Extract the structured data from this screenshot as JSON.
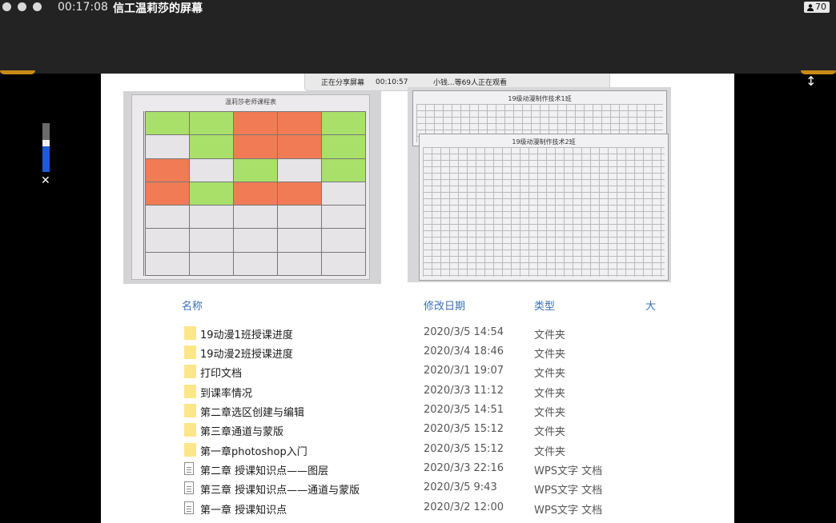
{
  "titlebar": {
    "timer": "00:17:08",
    "share_title": "信工温莉莎的屏幕",
    "viewer_count": "70",
    "viewer_icon": "person-icon"
  },
  "share_banner": {
    "sharing_label": "正在分享屏幕",
    "elapsed": "00:10:57",
    "watchers": "小钱...等69人正在观看"
  },
  "photos": {
    "schedule_title": "温莉莎老师课程表",
    "sheet1_title": "19级动漫制作技术1班",
    "sheet2_title": "19级动漫制作技术2班"
  },
  "file_list": {
    "columns": [
      "名称",
      "修改日期",
      "类型",
      "大"
    ],
    "rows": [
      {
        "name": "19动漫1班授课进度",
        "date": "2020/3/5 14:54",
        "type": "文件夹",
        "icon": "folder-icon"
      },
      {
        "name": "19动漫2班授课进度",
        "date": "2020/3/4 18:46",
        "type": "文件夹",
        "icon": "folder-icon"
      },
      {
        "name": "打印文档",
        "date": "2020/3/1 19:07",
        "type": "文件夹",
        "icon": "folder-icon"
      },
      {
        "name": "到课率情况",
        "date": "2020/3/3 11:12",
        "type": "文件夹",
        "icon": "folder-icon"
      },
      {
        "name": "第二章选区创建与编辑",
        "date": "2020/3/5 14:51",
        "type": "文件夹",
        "icon": "folder-icon"
      },
      {
        "name": "第三章通道与蒙版",
        "date": "2020/3/5 15:12",
        "type": "文件夹",
        "icon": "folder-icon"
      },
      {
        "name": "第一章photoshop入门",
        "date": "2020/3/5 15:12",
        "type": "文件夹",
        "icon": "folder-icon"
      },
      {
        "name": "第二章  授课知识点——图层",
        "date": "2020/3/3 22:16",
        "type": "WPS文字 文档",
        "icon": "document-icon"
      },
      {
        "name": "第三章  授课知识点——通道与蒙版",
        "date": "2020/3/5 9:43",
        "type": "WPS文字 文档",
        "icon": "document-icon"
      },
      {
        "name": "第一章  授课知识点",
        "date": "2020/3/2 12:00",
        "type": "WPS文字 文档",
        "icon": "document-icon"
      }
    ]
  },
  "colors": {
    "accent_orange": "#c98a17",
    "volume_blue": "#1e5bd8",
    "folder_yellow": "#fbe68a",
    "header_blue": "#3b6fb6"
  },
  "volume_level": 0.52
}
